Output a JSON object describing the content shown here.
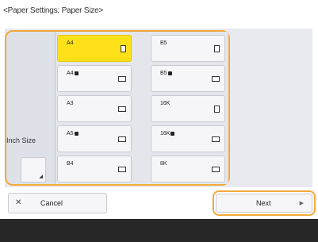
{
  "header": {
    "title": "<Paper Settings: Paper Size>"
  },
  "paper_sizes": [
    {
      "label": "A4",
      "badge": false,
      "orientation": "portrait",
      "selected": true
    },
    {
      "label": "B5",
      "badge": false,
      "orientation": "portrait",
      "selected": false
    },
    {
      "label": "A4",
      "badge": true,
      "orientation": "landscape",
      "selected": false
    },
    {
      "label": "B5",
      "badge": true,
      "orientation": "landscape",
      "selected": false
    },
    {
      "label": "A3",
      "badge": false,
      "orientation": "landscape",
      "selected": false
    },
    {
      "label": "16K",
      "badge": false,
      "orientation": "portrait",
      "selected": false
    },
    {
      "label": "A5",
      "badge": true,
      "orientation": "landscape",
      "selected": false
    },
    {
      "label": "16K",
      "badge": true,
      "orientation": "landscape",
      "selected": false
    },
    {
      "label": "B4",
      "badge": false,
      "orientation": "landscape",
      "selected": false
    },
    {
      "label": "8K",
      "badge": false,
      "orientation": "landscape",
      "selected": false
    }
  ],
  "inch_size": {
    "label": "Inch Size"
  },
  "footer_buttons": {
    "cancel_label": "Cancel",
    "next_label": "Next"
  },
  "colors": {
    "selected": "#ffe11a",
    "focus_ring": "#f3a93b",
    "footer_bar": "#262626"
  }
}
